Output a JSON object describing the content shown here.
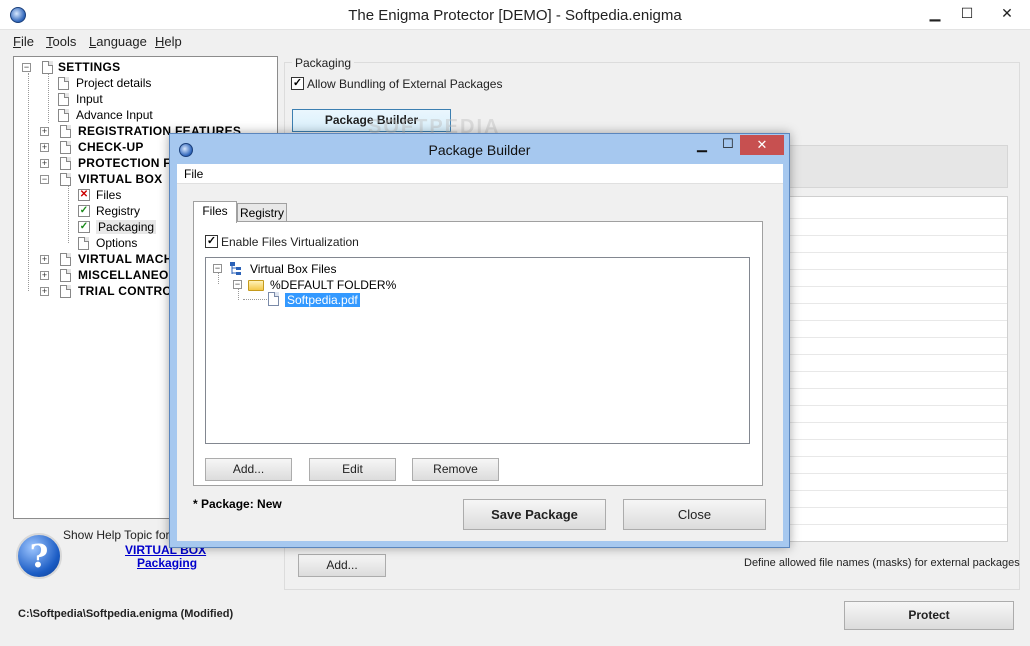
{
  "window": {
    "title": "The Enigma Protector [DEMO] - Softpedia.enigma",
    "min": "▁",
    "max": "☐",
    "close": "✕"
  },
  "menu": [
    "File",
    "Tools",
    "Language",
    "Help"
  ],
  "tree": {
    "settings": "SETTINGS",
    "project_details": "Project details",
    "input": "Input",
    "advance_input": "Advance Input",
    "registration": "REGISTRATION FEATURES",
    "checkup": "CHECK-UP",
    "protection": "PROTECTION F",
    "virtual_box": "VIRTUAL BOX",
    "files": "Files",
    "registry": "Registry",
    "packaging": "Packaging",
    "options": "Options",
    "virtual_mach": "VIRTUAL MACH",
    "miscellaneous": "MISCELLANEOU",
    "trial": "TRIAL CONTRO"
  },
  "help": {
    "show_topic": "Show Help Topic for:",
    "link1": "VIRTUAL BOX",
    "link2": "Packaging",
    "icon": "?"
  },
  "status": {
    "path": "C:\\Softpedia\\Softpedia.enigma  (Modified)"
  },
  "packaging": {
    "caption": "Packaging",
    "allow_bundling": "Allow Bundling of External Packages",
    "package_builder_btn": "Package Builder",
    "add_btn": "Add...",
    "define_text": "Define allowed file names (masks) for external packages",
    "protect_btn": "Protect",
    "watermark": "SOFTPEDIA"
  },
  "dialog": {
    "title": "Package Builder",
    "menu_file": "File",
    "tabs": [
      "Files",
      "Registry"
    ],
    "enable_virtualization": "Enable Files Virtualization",
    "tree_root": "Virtual Box Files",
    "tree_folder": "%DEFAULT FOLDER%",
    "tree_file": "Softpedia.pdf",
    "btn_add": "Add...",
    "btn_edit": "Edit",
    "btn_remove": "Remove",
    "package_status": "* Package: New",
    "btn_save": "Save Package",
    "btn_close": "Close",
    "min": "▁",
    "max": "☐",
    "close": "✕"
  },
  "checkmark": "✓",
  "cross": "✕",
  "plus": "+",
  "minus": "−"
}
